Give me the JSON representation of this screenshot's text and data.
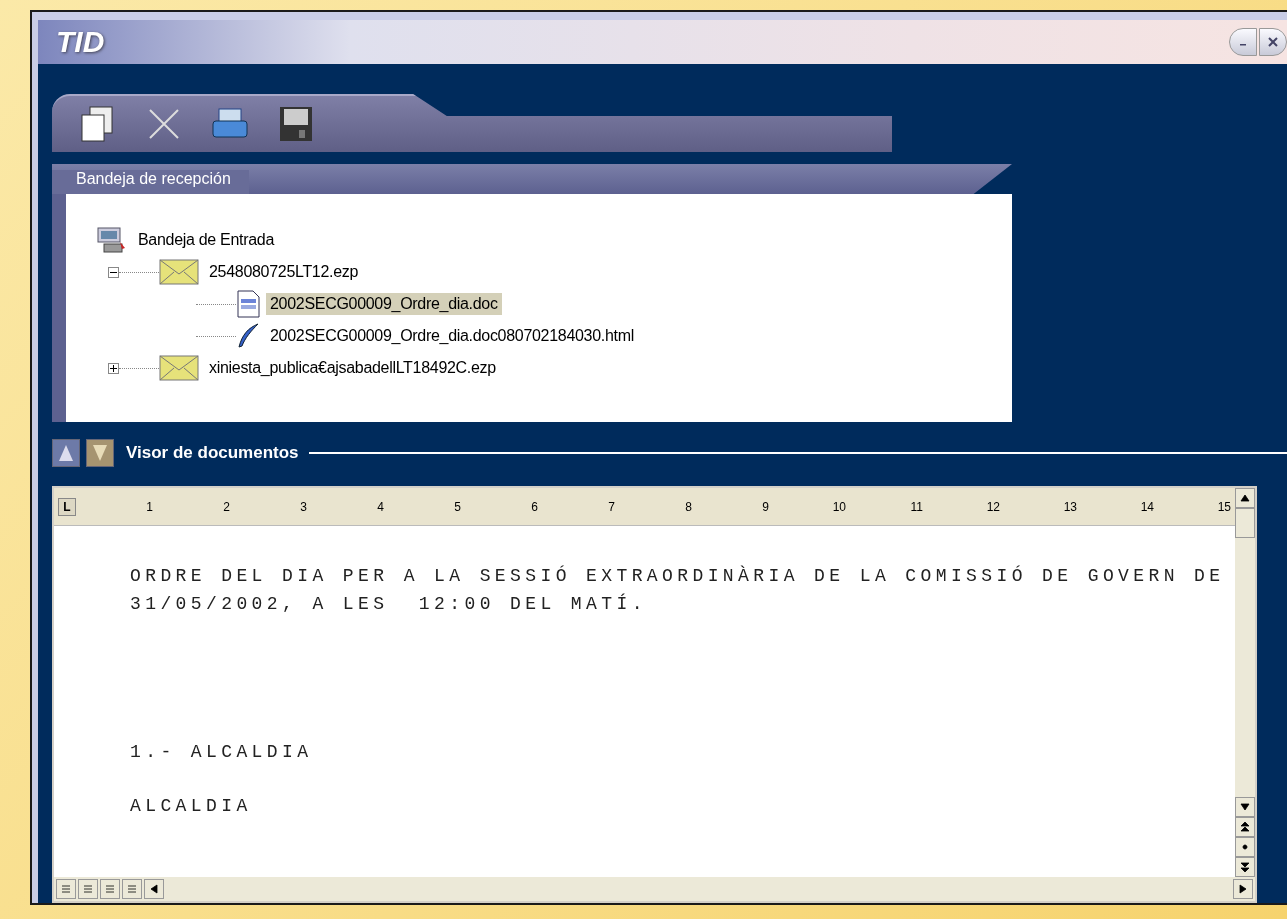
{
  "window": {
    "title": "TID"
  },
  "inbox": {
    "tab": "Bandeja de recepción",
    "tree": [
      {
        "label": "Bandeja de Entrada",
        "kind": "inbox",
        "selected": false,
        "children": [
          {
            "label": "2548080725LT12.ezp",
            "kind": "envelope",
            "selected": false,
            "expanded": true,
            "children": [
              {
                "label": "2002SECG00009_Ordre_dia.doc",
                "kind": "document",
                "selected": true
              },
              {
                "label": "2002SECG00009_Ordre_dia.doc080702184030.html",
                "kind": "web",
                "selected": false
              }
            ]
          },
          {
            "label": "xiniesta_publica€ajsabadellLT18492C.ezp",
            "kind": "envelope",
            "selected": false,
            "expanded": false
          }
        ]
      }
    ]
  },
  "viewer": {
    "title": "Visor de documentos",
    "tab_stop": "L",
    "ruler": [
      "1",
      "2",
      "3",
      "4",
      "5",
      "6",
      "7",
      "8",
      "9",
      "10",
      "11",
      "12",
      "13",
      "14",
      "15"
    ],
    "paragraphs": [
      {
        "kind": "title",
        "lines": [
          "ORDRE DEL DIA PER A LA SESSIÓ EXTRAORDINÀRIA DE LA COMISSIÓ DE GOVERN DE",
          "31/05/2002, A LES  12:00 DEL MATÍ."
        ]
      },
      {
        "kind": "section",
        "lines": [
          "1.- ALCALDIA"
        ]
      },
      {
        "kind": "subsection",
        "lines": [
          "ALCALDIA"
        ]
      }
    ]
  }
}
